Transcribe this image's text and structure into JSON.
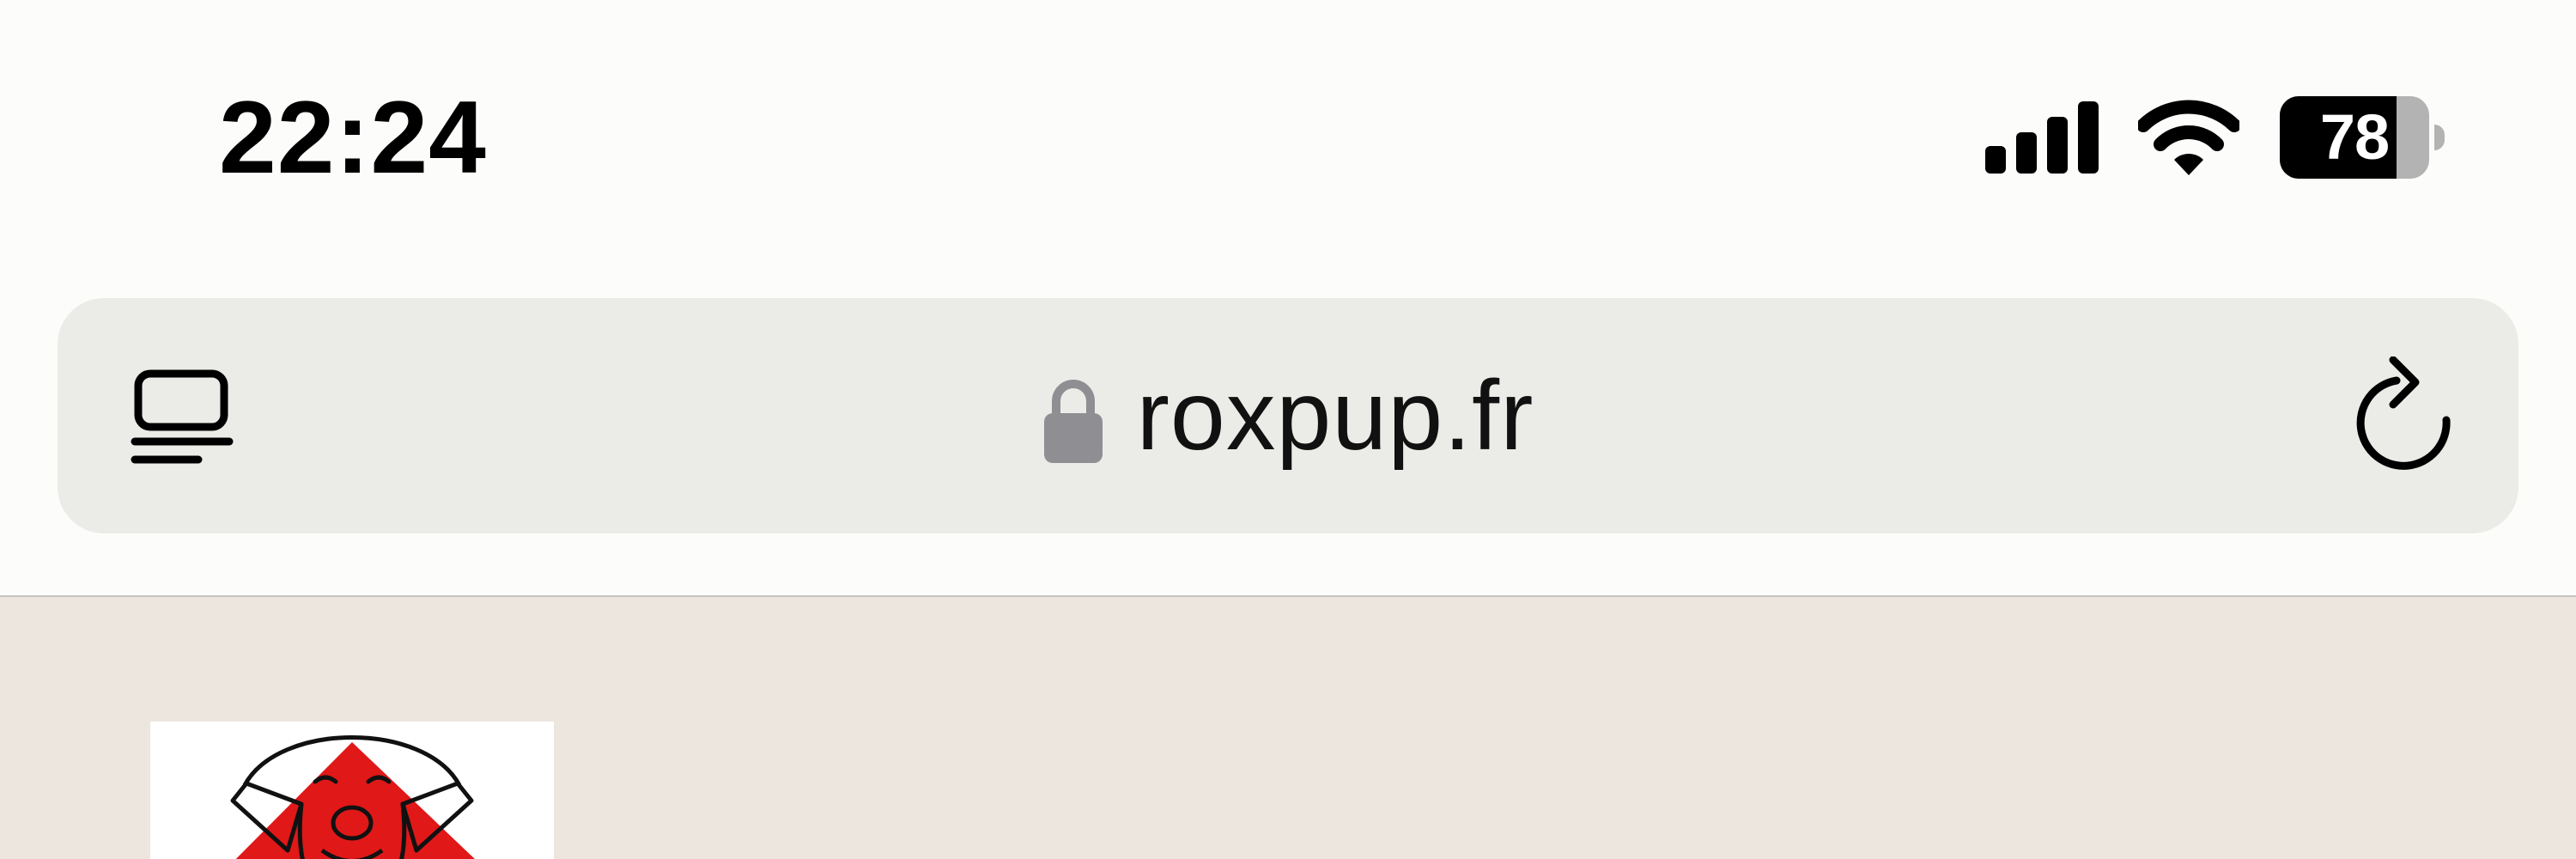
{
  "status_bar": {
    "time": "22:24",
    "signal_icon": "cellular-signal-icon",
    "wifi_icon": "wifi-icon",
    "battery": {
      "level_text": "78",
      "level_fraction": 0.78
    }
  },
  "address_bar": {
    "reader_icon": "reader-mode-icon",
    "lock_icon": "lock-icon",
    "url": "roxpup.fr",
    "reload_icon": "reload-icon"
  },
  "web_content": {
    "logo": "dog-head-logo",
    "colors": {
      "background": "#ede6df",
      "logo_accent": "#e01818"
    }
  },
  "colors": {
    "status_bar_bg": "#fcfcfa",
    "address_bar_bg": "#ebebe8",
    "lock_gray": "#8e8e93"
  }
}
